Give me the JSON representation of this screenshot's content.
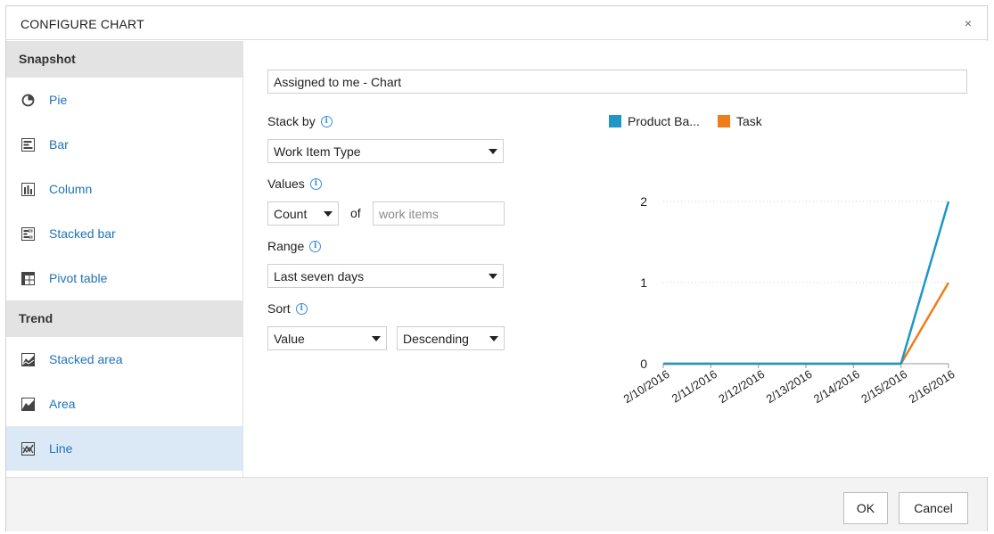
{
  "dialog": {
    "title": "CONFIGURE CHART",
    "close_label": "×"
  },
  "sidebar": {
    "groups": [
      {
        "header": "Snapshot",
        "items": [
          {
            "label": "Pie",
            "icon": "pie-icon"
          },
          {
            "label": "Bar",
            "icon": "bar-icon"
          },
          {
            "label": "Column",
            "icon": "column-icon"
          },
          {
            "label": "Stacked bar",
            "icon": "stacked-bar-icon"
          },
          {
            "label": "Pivot table",
            "icon": "pivot-table-icon"
          }
        ]
      },
      {
        "header": "Trend",
        "items": [
          {
            "label": "Stacked area",
            "icon": "stacked-area-icon"
          },
          {
            "label": "Area",
            "icon": "area-icon"
          },
          {
            "label": "Line",
            "icon": "line-icon",
            "selected": true
          }
        ]
      }
    ]
  },
  "form": {
    "chart_name": "Assigned to me - Chart",
    "stack_by_label": "Stack by",
    "stack_by_value": "Work Item Type",
    "values_label": "Values",
    "values_aggregation": "Count",
    "values_of": "of",
    "values_field_placeholder": "work items",
    "range_label": "Range",
    "range_value": "Last seven days",
    "sort_label": "Sort",
    "sort_field": "Value",
    "sort_direction": "Descending"
  },
  "chart_data": {
    "type": "line",
    "x": [
      "2/10/2016",
      "2/11/2016",
      "2/12/2016",
      "2/13/2016",
      "2/14/2016",
      "2/15/2016",
      "2/16/2016"
    ],
    "series": [
      {
        "name": "Product Ba...",
        "color": "#1e96c8",
        "values": [
          0,
          0,
          0,
          0,
          0,
          0,
          2
        ]
      },
      {
        "name": "Task",
        "color": "#f07d1a",
        "values": [
          0,
          0,
          0,
          0,
          0,
          0,
          1
        ]
      }
    ],
    "yticks": [
      0,
      1,
      2
    ],
    "ylim": [
      0,
      2
    ],
    "grid": true,
    "legend": "top"
  },
  "footer": {
    "ok_label": "OK",
    "cancel_label": "Cancel"
  },
  "colors": {
    "accent": "#1e73b8",
    "selected_bg": "#dbe9f7",
    "group_header_bg": "#e3e3e3"
  }
}
